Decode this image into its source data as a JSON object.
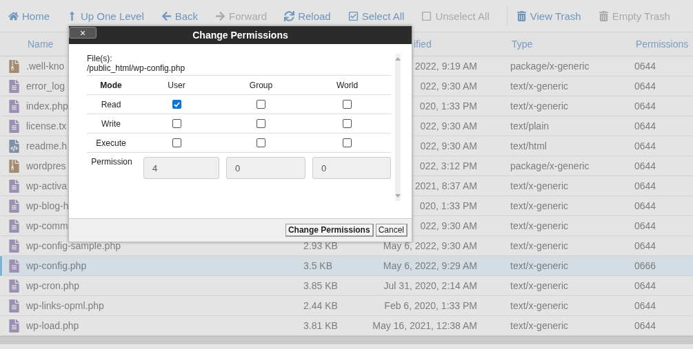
{
  "toolbar": [
    {
      "label": "Home",
      "disabled": false
    },
    {
      "label": "Up One Level",
      "disabled": false
    },
    {
      "label": "Back",
      "disabled": false
    },
    {
      "label": "Forward",
      "disabled": true
    },
    {
      "label": "Reload",
      "disabled": false
    },
    {
      "label": "Select All",
      "disabled": false
    },
    {
      "label": "Unselect All",
      "disabled": true
    },
    {
      "label": "View Trash",
      "disabled": false
    },
    {
      "label": "Empty Trash",
      "disabled": true
    }
  ],
  "table": {
    "columns": [
      "Name",
      "ified",
      "Type",
      "Permissions"
    ],
    "rows": [
      {
        "kind": "archive",
        "name": ".well-kno",
        "size": "",
        "modified": "2022, 9:19 AM",
        "type": "package/x-generic",
        "permissions": "0644",
        "selected": false
      },
      {
        "kind": "text",
        "name": "error_log",
        "size": "",
        "modified": "022, 9:30 AM",
        "type": "text/x-generic",
        "permissions": "0644",
        "selected": false
      },
      {
        "kind": "text",
        "name": "index.php",
        "size": "",
        "modified": "020, 1:33 PM",
        "type": "text/x-generic",
        "permissions": "0644",
        "selected": false
      },
      {
        "kind": "text",
        "name": "license.tx",
        "size": "",
        "modified": "022, 9:30 AM",
        "type": "text/plain",
        "permissions": "0644",
        "selected": false
      },
      {
        "kind": "code",
        "name": "readme.h",
        "size": "",
        "modified": "022, 9:30 AM",
        "type": "text/html",
        "permissions": "0644",
        "selected": false
      },
      {
        "kind": "archive",
        "name": "wordpres",
        "size": "",
        "modified": "022, 3:12 PM",
        "type": "package/x-generic",
        "permissions": "0644",
        "selected": false
      },
      {
        "kind": "text",
        "name": "wp-activa",
        "size": "",
        "modified": "2021, 8:37 AM",
        "type": "text/x-generic",
        "permissions": "0644",
        "selected": false
      },
      {
        "kind": "text",
        "name": "wp-blog-h",
        "size": "",
        "modified": "020, 1:33 PM",
        "type": "text/x-generic",
        "permissions": "0644",
        "selected": false
      },
      {
        "kind": "text",
        "name": "wp-comm",
        "size": "",
        "modified": "022, 9:30 AM",
        "type": "text/x-generic",
        "permissions": "0644",
        "selected": false
      },
      {
        "kind": "text",
        "name": "wp-config-sample.php",
        "size": "2.93 KB",
        "modified": "May 6, 2022, 9:30 AM",
        "type": "text/x-generic",
        "permissions": "0644",
        "selected": false
      },
      {
        "kind": "text",
        "name": "wp-config.php",
        "size": "3.5 KB",
        "modified": "May 6, 2022, 9:29 AM",
        "type": "text/x-generic",
        "permissions": "0666",
        "selected": true
      },
      {
        "kind": "text",
        "name": "wp-cron.php",
        "size": "3.85 KB",
        "modified": "Jul 31, 2020, 2:14 AM",
        "type": "text/x-generic",
        "permissions": "0644",
        "selected": false
      },
      {
        "kind": "text",
        "name": "wp-links-opml.php",
        "size": "2.44 KB",
        "modified": "Feb 6, 2020, 1:33 PM",
        "type": "text/x-generic",
        "permissions": "0644",
        "selected": false
      },
      {
        "kind": "text",
        "name": "wp-load.php",
        "size": "3.81 KB",
        "modified": "May 16, 2021, 12:38 AM",
        "type": "text/x-generic",
        "permissions": "0644",
        "selected": false
      }
    ]
  },
  "dialog": {
    "title": "Change Permissions",
    "close": "×",
    "files_label": "File(s):",
    "path": "/public_html/wp-config.php",
    "mode_header": "Mode",
    "headers": [
      "User",
      "Group",
      "World"
    ],
    "modes": [
      {
        "label": "Read",
        "checks": [
          true,
          false,
          false
        ]
      },
      {
        "label": "Write",
        "checks": [
          false,
          false,
          false
        ]
      },
      {
        "label": "Execute",
        "checks": [
          false,
          false,
          false
        ]
      }
    ],
    "permission_label": "Permission",
    "permission_values": [
      "4",
      "0",
      "0"
    ],
    "buttons": [
      "Change Permissions",
      "Cancel"
    ]
  }
}
